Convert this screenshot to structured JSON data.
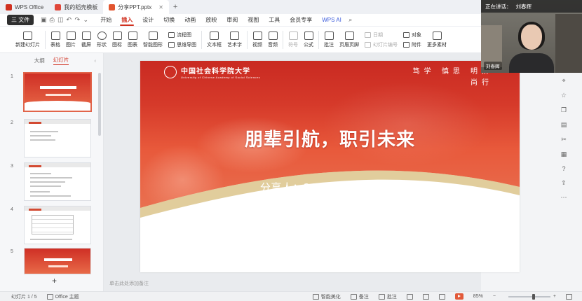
{
  "titlebar": {
    "tabs": [
      {
        "label": "WPS Office",
        "color": "#d0301f",
        "active": false
      },
      {
        "label": "我的稻壳模板",
        "color": "#e0473a",
        "active": false
      },
      {
        "label": "分享PPT.pptx",
        "color": "#e2552f",
        "active": true
      }
    ]
  },
  "menubar": {
    "file_label": "三 文件",
    "items": [
      "开始",
      "插入",
      "设计",
      "切换",
      "动画",
      "放映",
      "审阅",
      "视图",
      "工具",
      "会员专享",
      "WPS AI"
    ],
    "active": "插入"
  },
  "ribbon": {
    "buttons": [
      {
        "label": "新建幻灯片",
        "dim": false
      },
      {
        "label": "表格",
        "dim": false
      },
      {
        "label": "图片",
        "dim": false
      },
      {
        "label": "截屏",
        "dim": false
      },
      {
        "label": "形状",
        "dim": false
      },
      {
        "label": "图标",
        "dim": false
      },
      {
        "label": "图表",
        "dim": false
      },
      {
        "label": "智能图形",
        "dim": false
      }
    ],
    "stack1": [
      "流程图",
      "思维导图"
    ],
    "buttons2": [
      {
        "label": "文本框",
        "dim": false
      },
      {
        "label": "艺术字",
        "dim": false
      },
      {
        "label": "视频",
        "dim": false
      },
      {
        "label": "音频",
        "dim": false
      },
      {
        "label": "符号",
        "dim": true
      },
      {
        "label": "公式",
        "dim": false
      },
      {
        "label": "批注",
        "dim": false
      },
      {
        "label": "页眉页脚",
        "dim": false
      }
    ],
    "stack2": [
      "日期",
      "幻灯片编号"
    ],
    "stack3": [
      "对象",
      "附件"
    ],
    "more_label": "更多素材"
  },
  "leftpanel": {
    "tab_outline": "大纲",
    "tab_slides": "幻灯片",
    "slides": [
      "1",
      "2",
      "3",
      "4",
      "5"
    ],
    "add_label": "+"
  },
  "slide": {
    "logo_name": "中国社会科学院大学",
    "logo_sub": "University of Chinese Academy of Social Sciences",
    "motto_line1": "笃学 慎思 明辨",
    "motto_line2": "尚行",
    "title": "朋辈引航，职引未来",
    "subtitle": "分享人：2022级MBA刘春辉",
    "notes_placeholder": "单击此处添加备注"
  },
  "video": {
    "status": "正在讲话：",
    "speaker": "刘春辉"
  },
  "statusbar": {
    "slide_count": "幻灯片 1 / 5",
    "theme": "Office 主题",
    "smart": "智能美化",
    "notes": "备注",
    "comments": "批注",
    "zoom": "85%",
    "zoom_level": 0.6
  }
}
